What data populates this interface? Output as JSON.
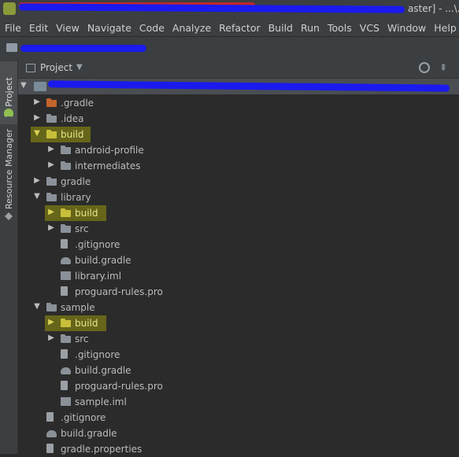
{
  "window": {
    "title_visible": "aster] - ...\\.id"
  },
  "menu": [
    "File",
    "Edit",
    "View",
    "Navigate",
    "Code",
    "Analyze",
    "Refactor",
    "Build",
    "Run",
    "Tools",
    "VCS",
    "Window",
    "Help"
  ],
  "side_tabs": {
    "project": "1: Project",
    "resource_manager": "Resource Manager"
  },
  "panel": {
    "title": "Project",
    "dropdown_icon": "chevron-down-icon"
  },
  "tree": [
    {
      "name": ".gradle",
      "indent": 1,
      "arrow": "collapsed",
      "icon": "folder-orange",
      "highlight": false
    },
    {
      "name": ".idea",
      "indent": 1,
      "arrow": "collapsed",
      "icon": "folder",
      "highlight": false
    },
    {
      "name": "build",
      "indent": 1,
      "arrow": "expanded",
      "icon": "folder-yellow",
      "highlight": true
    },
    {
      "name": "android-profile",
      "indent": 2,
      "arrow": "collapsed",
      "icon": "folder",
      "highlight": false
    },
    {
      "name": "intermediates",
      "indent": 2,
      "arrow": "collapsed",
      "icon": "folder",
      "highlight": false
    },
    {
      "name": "gradle",
      "indent": 1,
      "arrow": "collapsed",
      "icon": "folder",
      "highlight": false
    },
    {
      "name": "library",
      "indent": 1,
      "arrow": "expanded",
      "icon": "folder-module",
      "highlight": false
    },
    {
      "name": "build",
      "indent": 2,
      "arrow": "collapsed",
      "icon": "folder-yellow",
      "highlight": true
    },
    {
      "name": "src",
      "indent": 2,
      "arrow": "collapsed",
      "icon": "folder",
      "highlight": false
    },
    {
      "name": ".gitignore",
      "indent": 2,
      "arrow": "none",
      "icon": "file",
      "highlight": false
    },
    {
      "name": "build.gradle",
      "indent": 2,
      "arrow": "none",
      "icon": "gradle",
      "highlight": false
    },
    {
      "name": "library.iml",
      "indent": 2,
      "arrow": "none",
      "icon": "iml",
      "highlight": false
    },
    {
      "name": "proguard-rules.pro",
      "indent": 2,
      "arrow": "none",
      "icon": "file",
      "highlight": false
    },
    {
      "name": "sample",
      "indent": 1,
      "arrow": "expanded",
      "icon": "folder-module",
      "highlight": false
    },
    {
      "name": "build",
      "indent": 2,
      "arrow": "collapsed",
      "icon": "folder-yellow",
      "highlight": true
    },
    {
      "name": "src",
      "indent": 2,
      "arrow": "collapsed",
      "icon": "folder",
      "highlight": false
    },
    {
      "name": ".gitignore",
      "indent": 2,
      "arrow": "none",
      "icon": "file",
      "highlight": false
    },
    {
      "name": "build.gradle",
      "indent": 2,
      "arrow": "none",
      "icon": "gradle",
      "highlight": false
    },
    {
      "name": "proguard-rules.pro",
      "indent": 2,
      "arrow": "none",
      "icon": "file",
      "highlight": false
    },
    {
      "name": "sample.iml",
      "indent": 2,
      "arrow": "none",
      "icon": "iml",
      "highlight": false
    },
    {
      "name": ".gitignore",
      "indent": 1,
      "arrow": "none",
      "icon": "file",
      "highlight": false
    },
    {
      "name": "build.gradle",
      "indent": 1,
      "arrow": "none",
      "icon": "gradle",
      "highlight": false
    },
    {
      "name": "gradle.properties",
      "indent": 1,
      "arrow": "none",
      "icon": "file",
      "highlight": false
    }
  ]
}
